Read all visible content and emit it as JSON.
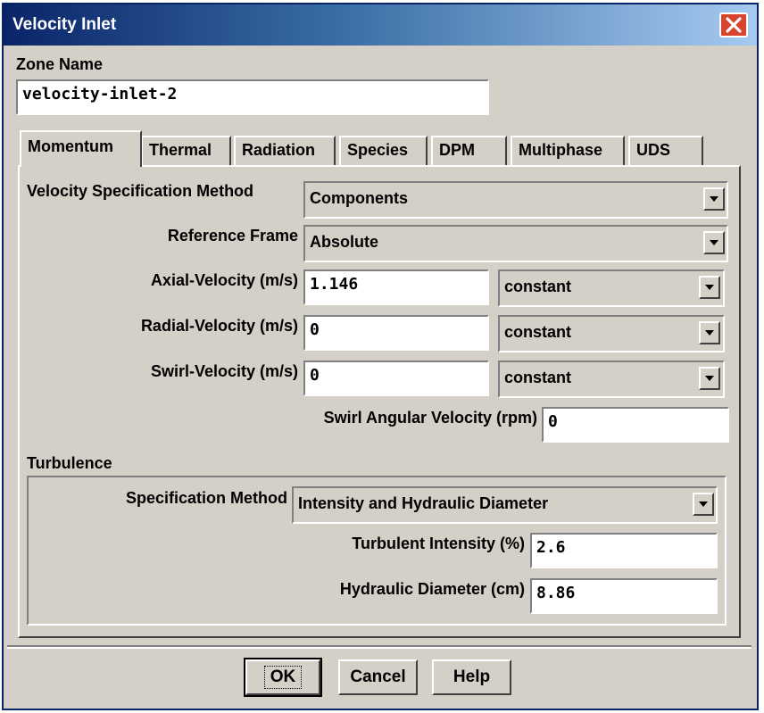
{
  "window": {
    "title": "Velocity Inlet"
  },
  "zone": {
    "label": "Zone Name",
    "value": "velocity-inlet-2"
  },
  "tabs": [
    "Momentum",
    "Thermal",
    "Radiation",
    "Species",
    "DPM",
    "Multiphase",
    "UDS"
  ],
  "momentum": {
    "velocity_spec_label": "Velocity Specification Method",
    "velocity_spec_value": "Components",
    "reference_frame_label": "Reference Frame",
    "reference_frame_value": "Absolute",
    "axial_label": "Axial-Velocity (m/s)",
    "axial_value": "1.146",
    "axial_profile": "constant",
    "radial_label": "Radial-Velocity (m/s)",
    "radial_value": "0",
    "radial_profile": "constant",
    "swirl_label": "Swirl-Velocity (m/s)",
    "swirl_value": "0",
    "swirl_profile": "constant",
    "swirl_angular_label": "Swirl Angular Velocity (rpm)",
    "swirl_angular_value": "0"
  },
  "turbulence": {
    "heading": "Turbulence",
    "spec_label": "Specification Method",
    "spec_value": "Intensity and Hydraulic Diameter",
    "intensity_label": "Turbulent Intensity (%)",
    "intensity_value": "2.6",
    "diameter_label": "Hydraulic Diameter (cm)",
    "diameter_value": "8.86"
  },
  "buttons": {
    "ok": "OK",
    "cancel": "Cancel",
    "help": "Help"
  }
}
